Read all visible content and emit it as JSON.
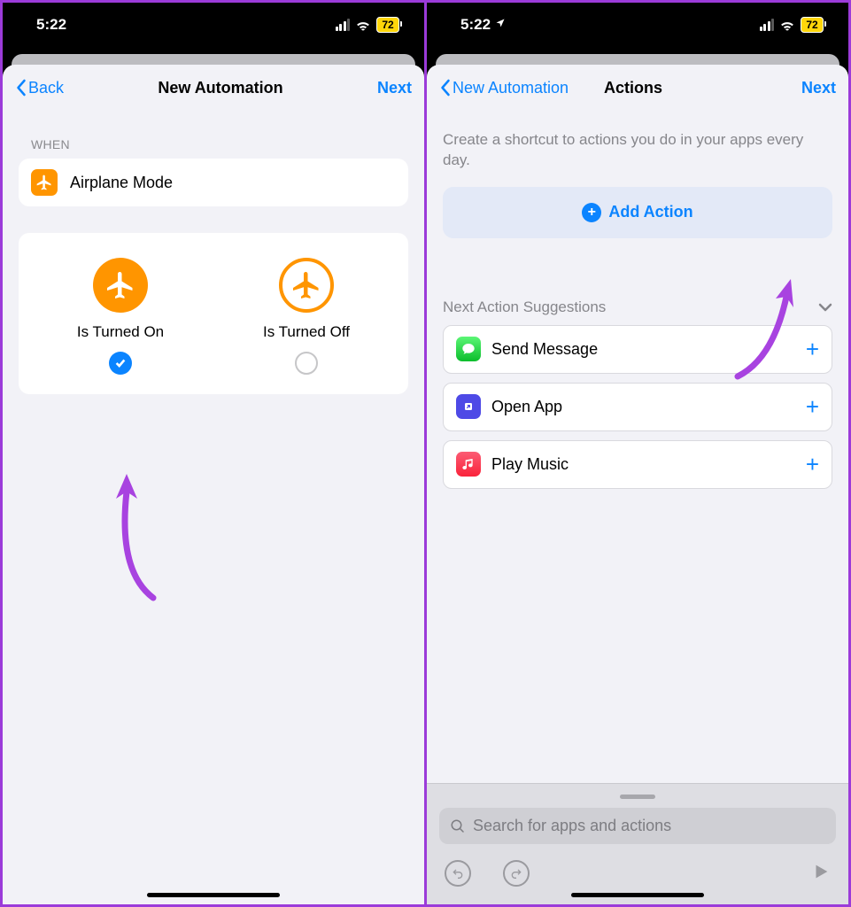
{
  "status": {
    "time": "5:22",
    "battery": "72",
    "location_icon": "location-arrow"
  },
  "left_screen": {
    "nav": {
      "back": "Back",
      "title": "New Automation",
      "next": "Next"
    },
    "section_label": "WHEN",
    "trigger": {
      "label": "Airplane Mode"
    },
    "options": [
      {
        "label": "Is Turned On",
        "selected": true
      },
      {
        "label": "Is Turned Off",
        "selected": false
      }
    ]
  },
  "right_screen": {
    "nav": {
      "back": "New Automation",
      "title": "Actions",
      "next": "Next"
    },
    "description": "Create a shortcut to actions you do in your apps every day.",
    "add_action": "Add Action",
    "suggestions_header": "Next Action Suggestions",
    "suggestions": [
      {
        "icon": "messages",
        "label": "Send Message"
      },
      {
        "icon": "shortcuts",
        "label": "Open App"
      },
      {
        "icon": "music",
        "label": "Play Music"
      }
    ],
    "search_placeholder": "Search for apps and actions"
  },
  "colors": {
    "accent_blue": "#0b84ff",
    "orange": "#ff9500",
    "purple_arrow": "#a843e0"
  }
}
